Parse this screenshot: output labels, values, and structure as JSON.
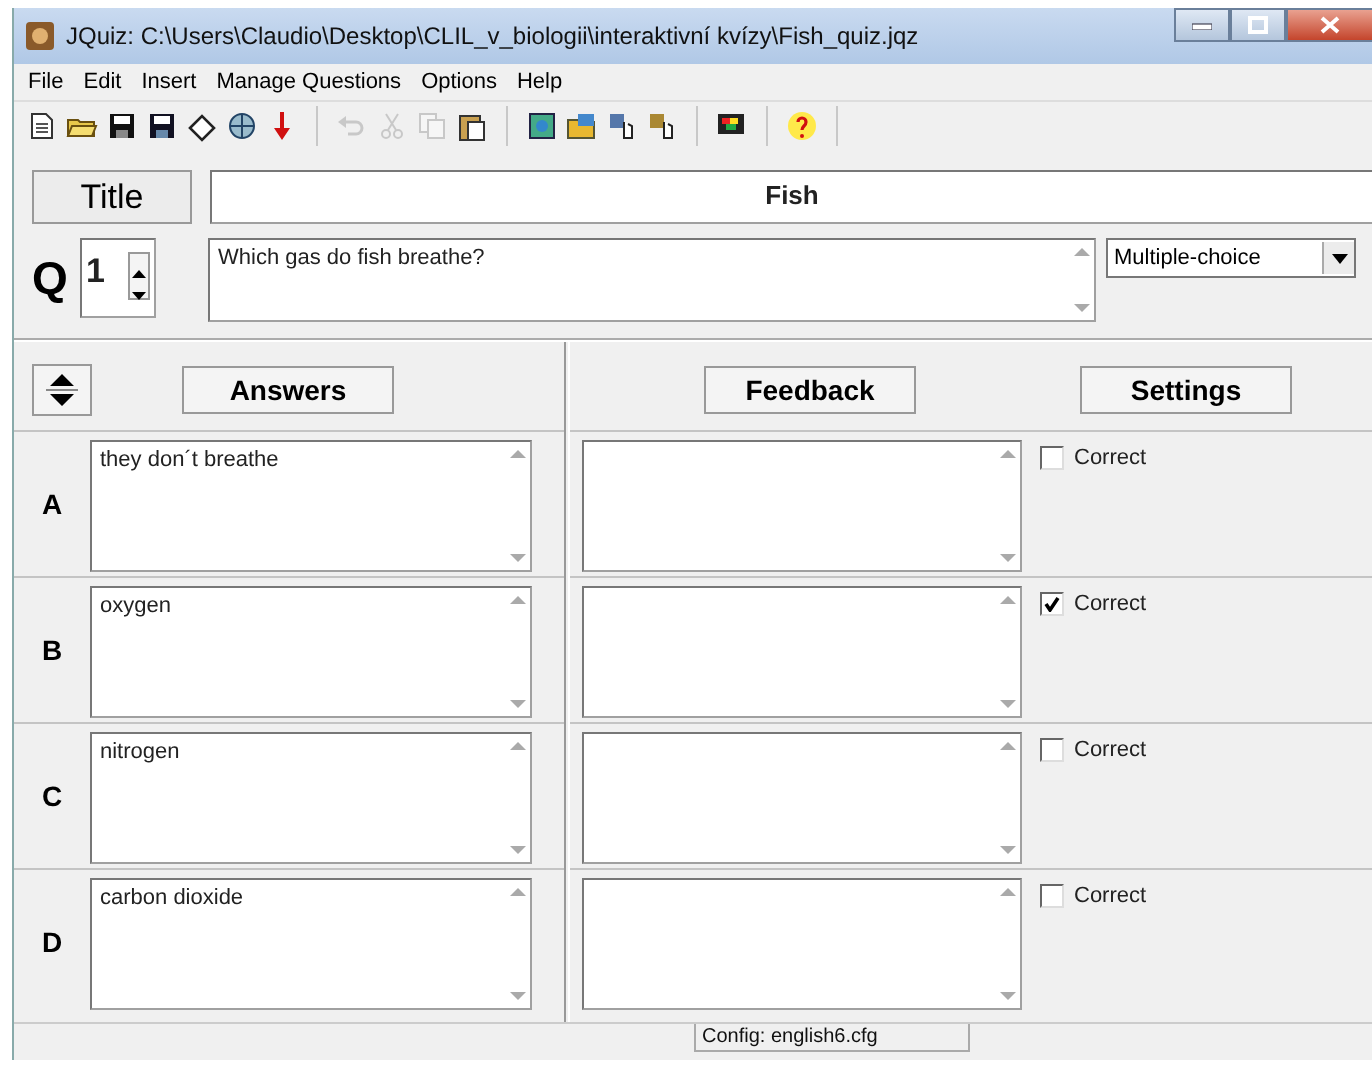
{
  "window": {
    "title": "JQuiz: C:\\Users\\Claudio\\Desktop\\CLIL_v_biologii\\interaktivní kvízy\\Fish_quiz.jqz"
  },
  "menu": [
    "File",
    "Edit",
    "Insert",
    "Manage Questions",
    "Options",
    "Help"
  ],
  "toolbar": [
    [
      {
        "disabled": false
      },
      {
        "disabled": false
      },
      {
        "disabled": false
      },
      {
        "disabled": false
      },
      {
        "disabled": false
      },
      {
        "disabled": false
      },
      {
        "disabled": false
      }
    ],
    [
      {
        "disabled": true
      },
      {
        "disabled": true
      },
      {
        "disabled": true
      },
      {
        "disabled": false
      }
    ],
    [
      {
        "disabled": false
      },
      {
        "disabled": false
      },
      {
        "disabled": false
      },
      {
        "disabled": false
      }
    ],
    [
      {
        "disabled": false
      }
    ],
    [
      {
        "disabled": false
      }
    ]
  ],
  "quiz": {
    "title_button": "Title",
    "title": "Fish",
    "q_label": "Q",
    "question_number": "1",
    "question": "Which gas do fish breathe?",
    "question_type": "Multiple-choice"
  },
  "headers": {
    "answers": "Answers",
    "feedback": "Feedback",
    "settings": "Settings"
  },
  "answers": [
    {
      "letter": "A",
      "text": "they don´t breathe",
      "correct_label": "Correct",
      "correct": false
    },
    {
      "letter": "B",
      "text": "oxygen",
      "correct_label": "Correct",
      "correct": true
    },
    {
      "letter": "C",
      "text": "nitrogen",
      "correct_label": "Correct",
      "correct": false
    },
    {
      "letter": "D",
      "text": "carbon dioxide",
      "correct_label": "Correct",
      "correct": false
    }
  ],
  "status_bar": "Config: english6.cfg"
}
